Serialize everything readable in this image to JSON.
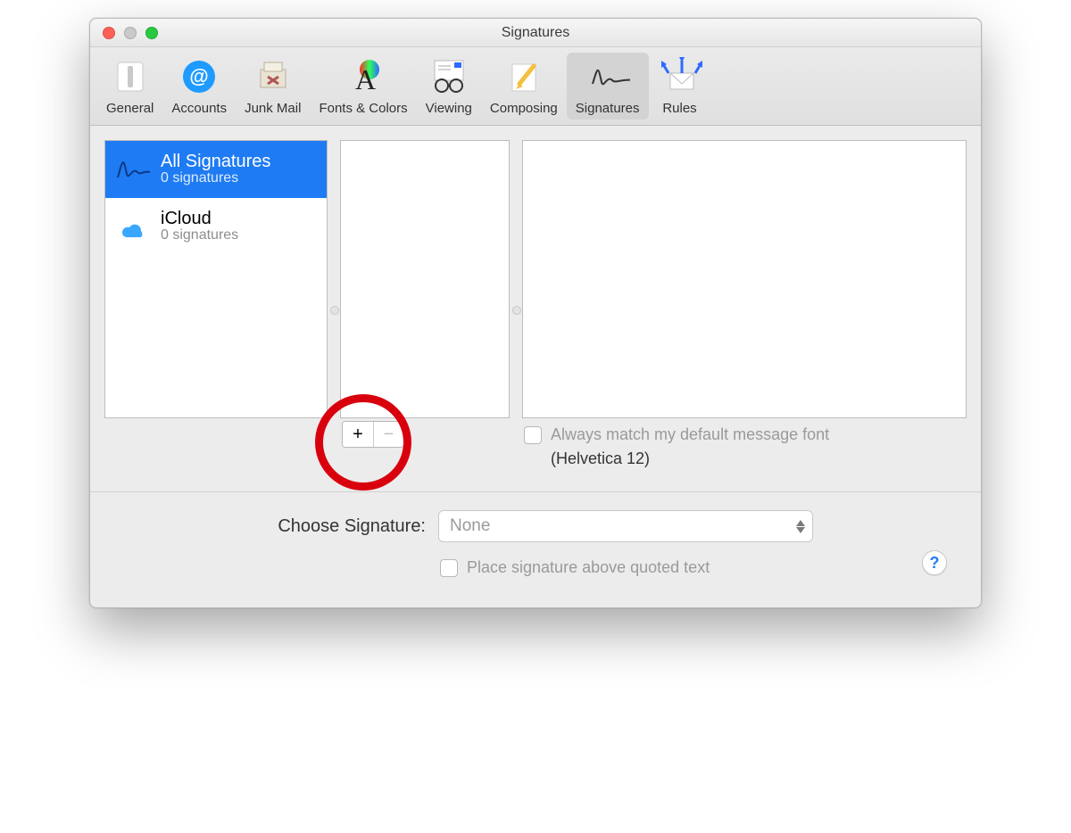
{
  "window": {
    "title": "Signatures"
  },
  "toolbar": {
    "items": [
      {
        "label": "General"
      },
      {
        "label": "Accounts"
      },
      {
        "label": "Junk Mail"
      },
      {
        "label": "Fonts & Colors"
      },
      {
        "label": "Viewing"
      },
      {
        "label": "Composing"
      },
      {
        "label": "Signatures"
      },
      {
        "label": "Rules"
      }
    ],
    "selected_index": 6
  },
  "accounts_pane": {
    "items": [
      {
        "name": "All Signatures",
        "sub": "0 signatures",
        "selected": true
      },
      {
        "name": "iCloud",
        "sub": "0 signatures",
        "selected": false
      }
    ]
  },
  "match_font": {
    "checkbox_label": "Always match my default message font",
    "note": "(Helvetica 12)"
  },
  "choose_signature": {
    "label": "Choose Signature:",
    "value": "None"
  },
  "place_above": {
    "label": "Place signature above quoted text"
  },
  "help": "?"
}
